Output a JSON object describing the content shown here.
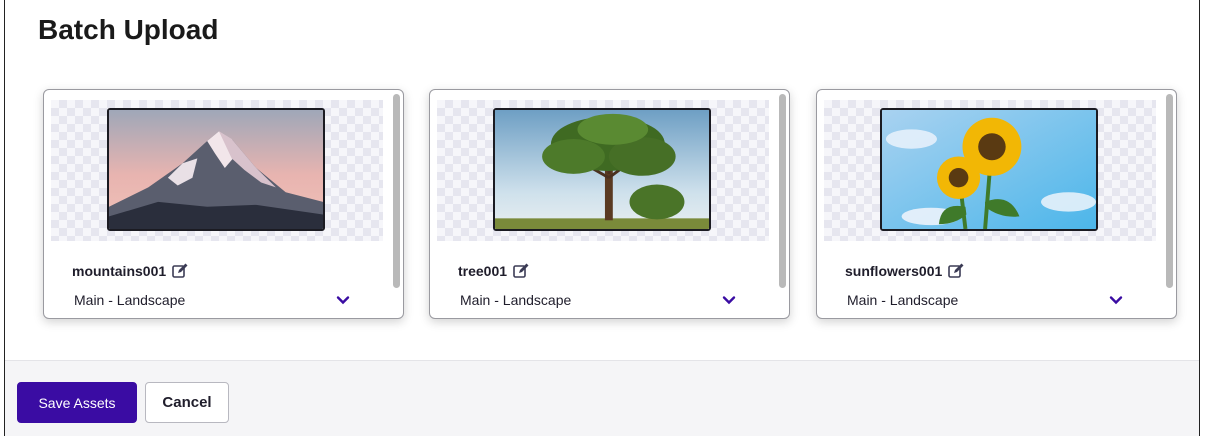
{
  "dialog": {
    "title": "Batch Upload"
  },
  "assets": [
    {
      "name": "mountains001",
      "category": "Main - Landscape",
      "image": "mountain-photo"
    },
    {
      "name": "tree001",
      "category": "Main - Landscape",
      "image": "tree-photo"
    },
    {
      "name": "sunflowers001",
      "category": "Main - Landscape",
      "image": "sunflower-photo"
    }
  ],
  "footer": {
    "save_label": "Save Assets",
    "cancel_label": "Cancel"
  },
  "colors": {
    "accent": "#3a0ca3",
    "chevron": "#3a0ca3"
  },
  "icons": {
    "edit": "edit-icon",
    "dropdown": "chevron-down-icon"
  }
}
